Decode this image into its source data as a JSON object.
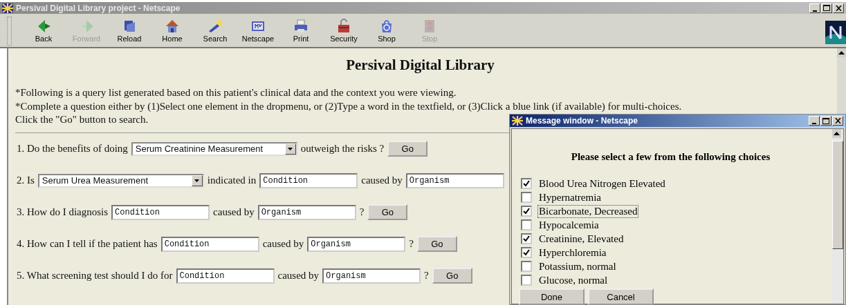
{
  "window": {
    "title": "Persival Digital Library project - Netscape"
  },
  "toolbar": [
    {
      "label": "Back",
      "disabled": false
    },
    {
      "label": "Forward",
      "disabled": true
    },
    {
      "label": "Reload",
      "disabled": false
    },
    {
      "label": "Home",
      "disabled": false
    },
    {
      "label": "Search",
      "disabled": false
    },
    {
      "label": "Netscape",
      "disabled": false
    },
    {
      "label": "Print",
      "disabled": false
    },
    {
      "label": "Security",
      "disabled": false
    },
    {
      "label": "Shop",
      "disabled": false
    },
    {
      "label": "Stop",
      "disabled": true
    }
  ],
  "page": {
    "heading": "Persival Digital Library",
    "instructions": [
      "*Following is a query list generated based on this patient's clinical data and the context you were viewing.",
      "*Complete a question either by (1)Select one element in the dropmenu, or (2)Type a word in the textfield, or (3)Click a blue link (if available) for multi-choices.",
      "Click the \"Go\" button to search."
    ],
    "questions": [
      {
        "parts": [
          {
            "kind": "text",
            "text": "1. Do the benefits of doing"
          },
          {
            "kind": "select",
            "value": "Serum Creatinine Measurement"
          },
          {
            "kind": "text",
            "text": "outweigh the risks ?"
          },
          {
            "kind": "button",
            "text": "Go"
          }
        ]
      },
      {
        "parts": [
          {
            "kind": "text",
            "text": "2. Is"
          },
          {
            "kind": "select",
            "value": "Serum Urea Measurement"
          },
          {
            "kind": "text",
            "text": "indicated in"
          },
          {
            "kind": "input",
            "value": "Condition"
          },
          {
            "kind": "text",
            "text": "caused by"
          },
          {
            "kind": "input",
            "value": "Organism"
          }
        ]
      },
      {
        "parts": [
          {
            "kind": "text",
            "text": "3. How do I diagnosis"
          },
          {
            "kind": "input",
            "value": "Condition"
          },
          {
            "kind": "text",
            "text": "caused by"
          },
          {
            "kind": "input",
            "value": "Organism"
          },
          {
            "kind": "text",
            "text": "?"
          },
          {
            "kind": "button",
            "text": "Go"
          }
        ]
      },
      {
        "parts": [
          {
            "kind": "text",
            "text": "4. How can I tell if the patient has"
          },
          {
            "kind": "input",
            "value": "Condition"
          },
          {
            "kind": "text",
            "text": "caused by"
          },
          {
            "kind": "input",
            "value": "Organism"
          },
          {
            "kind": "text",
            "text": "?"
          },
          {
            "kind": "button",
            "text": "Go"
          }
        ]
      },
      {
        "parts": [
          {
            "kind": "text",
            "text": "5. What screening test should I do for"
          },
          {
            "kind": "input",
            "value": "Condition"
          },
          {
            "kind": "text",
            "text": "caused by"
          },
          {
            "kind": "input",
            "value": "Organism"
          },
          {
            "kind": "text",
            "text": "?"
          },
          {
            "kind": "button",
            "text": "Go"
          }
        ]
      }
    ]
  },
  "popup": {
    "title": "Message window - Netscape",
    "heading": "Please select a few from the following choices",
    "choices": [
      {
        "label": "Blood Urea Nitrogen Elevated",
        "checked": true,
        "focused": false
      },
      {
        "label": "Hypernatremia",
        "checked": false,
        "focused": false
      },
      {
        "label": "Bicarbonate, Decreased",
        "checked": true,
        "focused": true
      },
      {
        "label": "Hypocalcemia",
        "checked": false,
        "focused": false
      },
      {
        "label": "Creatinine, Elevated",
        "checked": true,
        "focused": false
      },
      {
        "label": "Hyperchloremia",
        "checked": true,
        "focused": false
      },
      {
        "label": "Potassium, normal",
        "checked": false,
        "focused": false
      },
      {
        "label": "Glucose, normal",
        "checked": false,
        "focused": false
      }
    ],
    "buttons": [
      "Done",
      "Cancel"
    ]
  }
}
